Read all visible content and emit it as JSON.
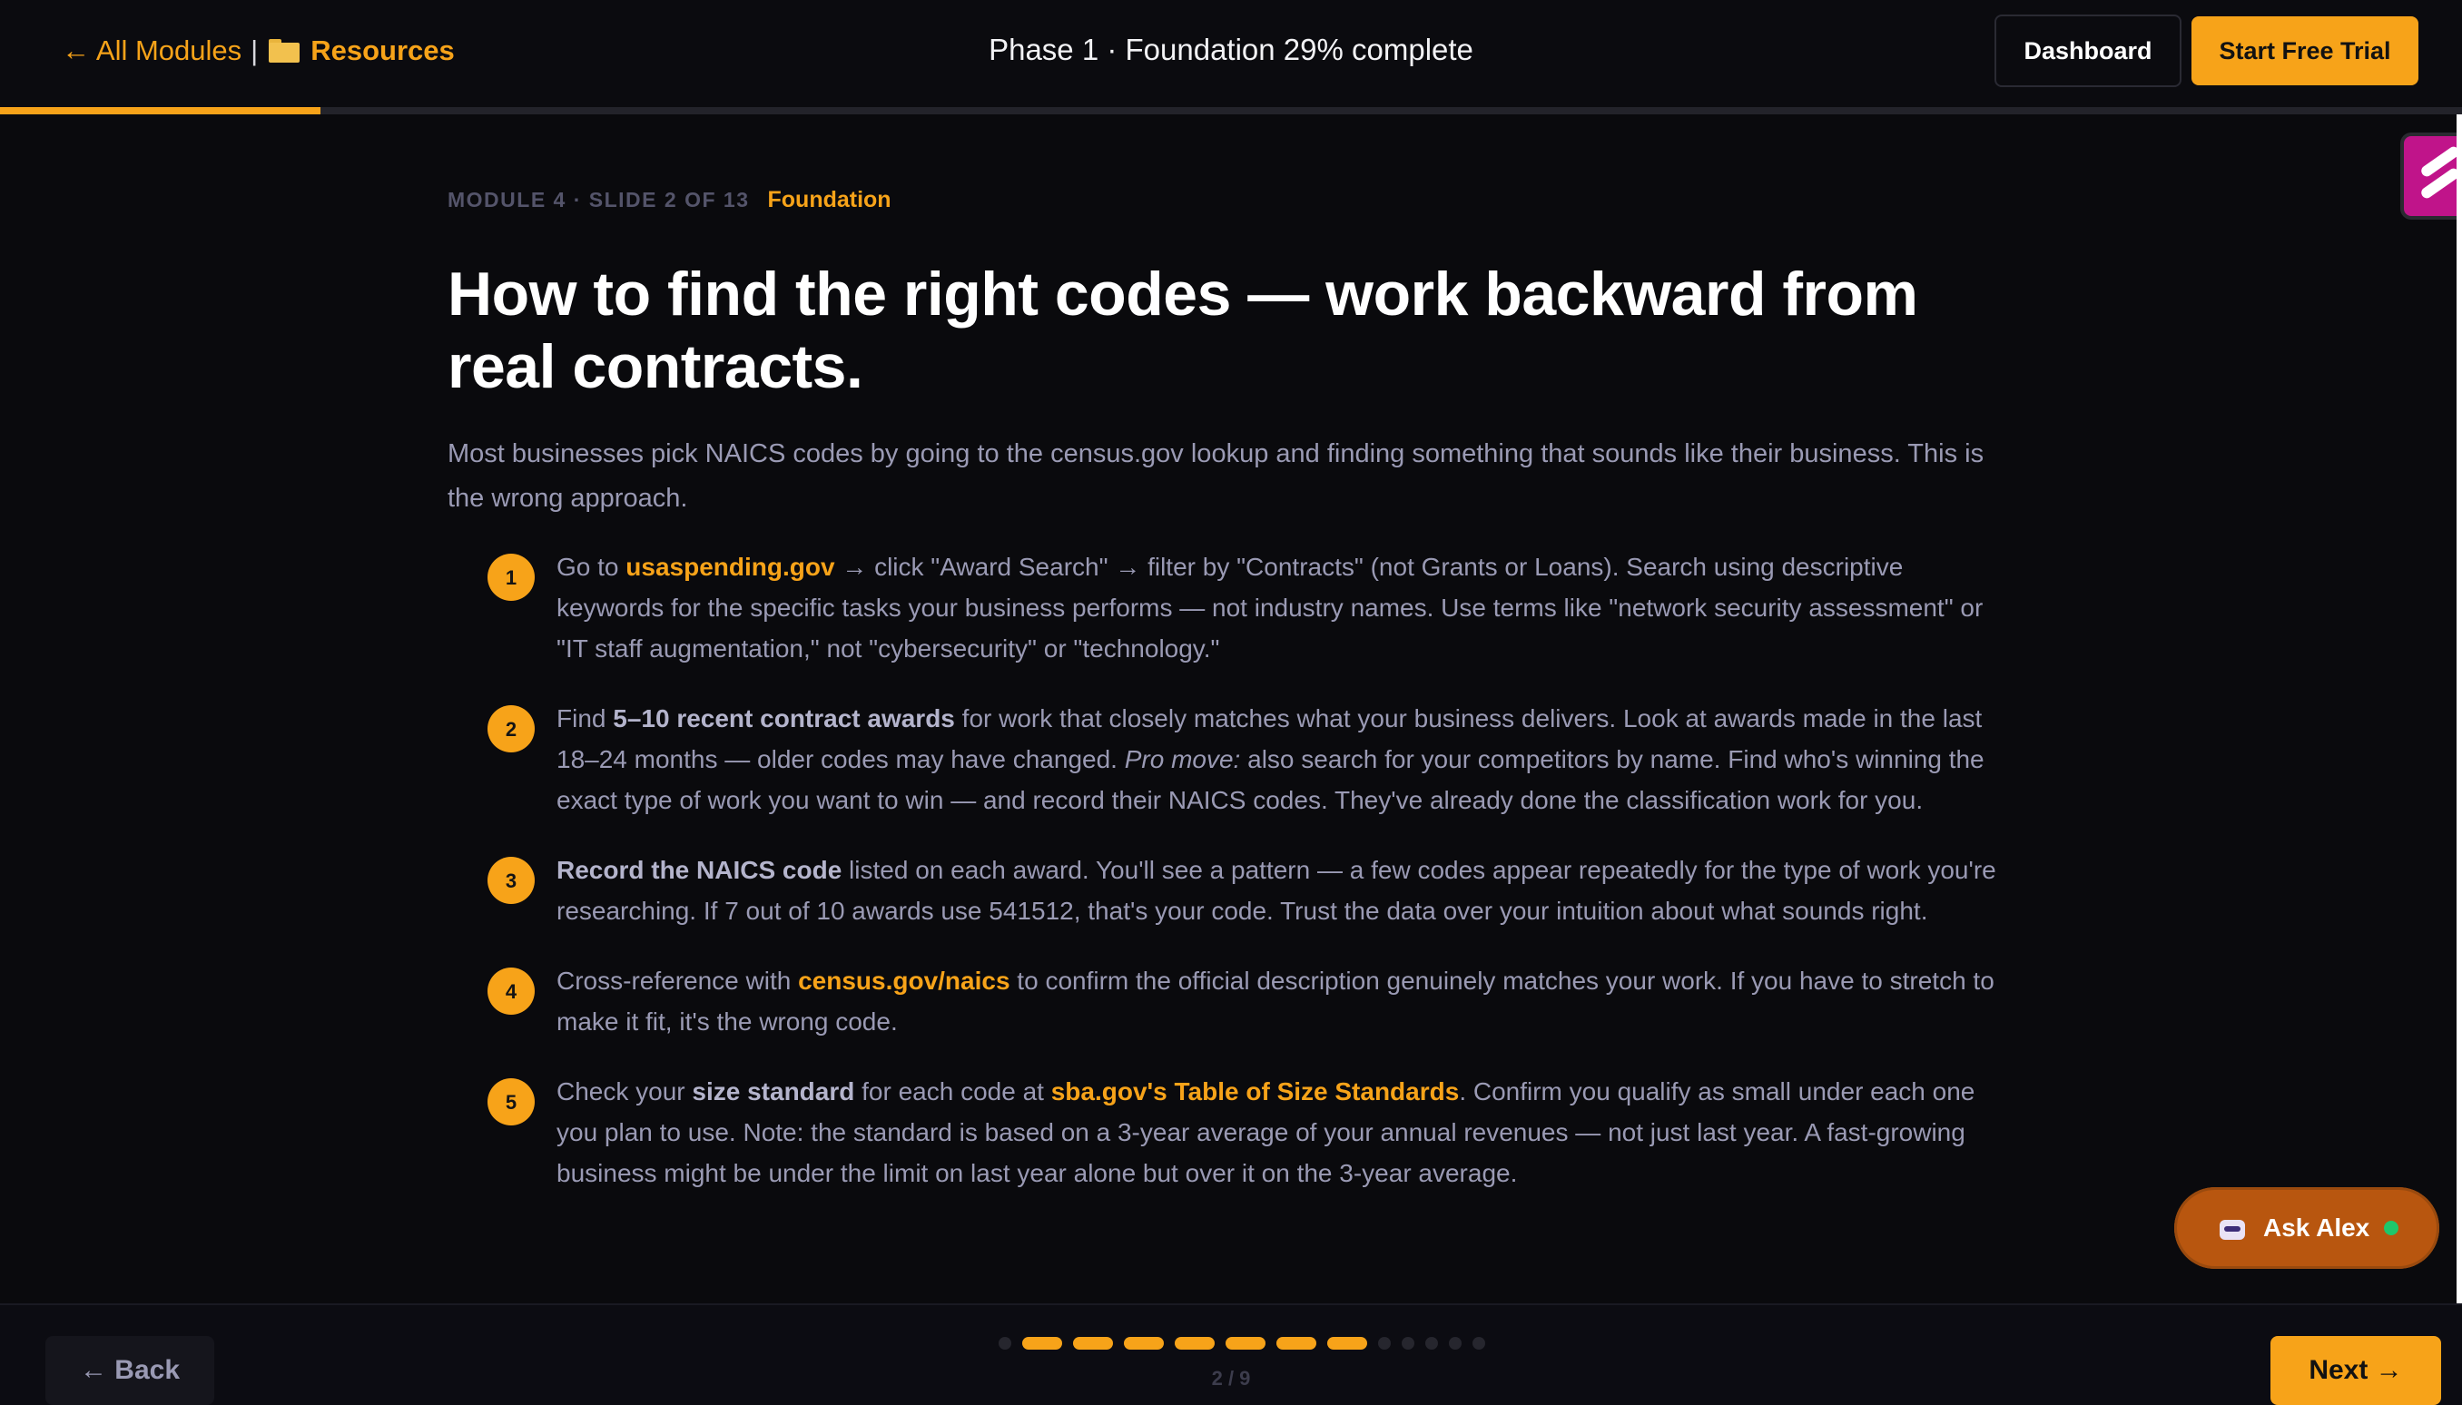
{
  "header": {
    "back_link": "← All Modules",
    "separator": "|",
    "resources": "Resources",
    "phase_text": "Phase 1 · Foundation 29% complete",
    "dashboard": "Dashboard",
    "trial": "Start Free Trial",
    "progress_fraction": 0.13
  },
  "slide": {
    "crumb": "MODULE 4 · SLIDE 2 OF 13",
    "tag": "Foundation",
    "title": "How to find the right codes — work backward from real contracts.",
    "intro": "Most businesses pick NAICS codes by going to the census.gov lookup and finding something that sounds like their business. This is the wrong approach."
  },
  "steps": [
    {
      "num": "1",
      "pre": "Go to ",
      "link": "usaspending.gov",
      "post": " → click \"Award Search\" → filter by \"Contracts\" (not Grants or Loans). Search using descriptive keywords for the specific tasks your business performs — not industry names. Use terms like \"network security assessment\" or \"IT staff augmentation,\" not \"cybersecurity\" or \"technology.\""
    },
    {
      "num": "2",
      "pre": "Find ",
      "bold": "5–10 recent contract awards",
      "mid": " for work that closely matches what your business delivers. Look at awards made in the last 18–24 months — older codes may have changed. ",
      "em": "Pro move:",
      "post": " also search for your competitors by name. Find who's winning the exact type of work you want to win — and record their NAICS codes. They've already done the classification work for you."
    },
    {
      "num": "3",
      "bold": "Record the NAICS code",
      "post": " listed on each award. You'll see a pattern — a few codes appear repeatedly for the type of work you're researching. If 7 out of 10 awards use 541512, that's your code. Trust the data over your intuition about what sounds right."
    },
    {
      "num": "4",
      "pre": "Cross-reference with ",
      "link": "census.gov/naics",
      "post": " to confirm the official description genuinely matches your work. If you have to stretch to make it fit, it's the wrong code."
    },
    {
      "num": "5",
      "pre": "Check your ",
      "bold": "size standard",
      "mid": " for each code at ",
      "link": "sba.gov's Table of Size Standards",
      "post": ". Confirm you qualify as small under each one you plan to use. Note: the standard is based on a 3-year average of your annual revenues — not just last year. A fast-growing business might be under the limit on last year alone but over it on the 3-year average."
    }
  ],
  "chat": {
    "label": "Ask Alex",
    "status_color": "#1ec76b"
  },
  "footer": {
    "back": "← Back",
    "next": "Next →",
    "counter": "2 / 9",
    "dots": [
      "todo",
      "done",
      "done",
      "done",
      "done",
      "done",
      "done",
      "cur",
      "todo",
      "todo",
      "todo",
      "todo",
      "todo"
    ]
  },
  "colors": {
    "accent": "#f7a319",
    "background": "#0a0a0d",
    "widget": "#c0148a"
  }
}
